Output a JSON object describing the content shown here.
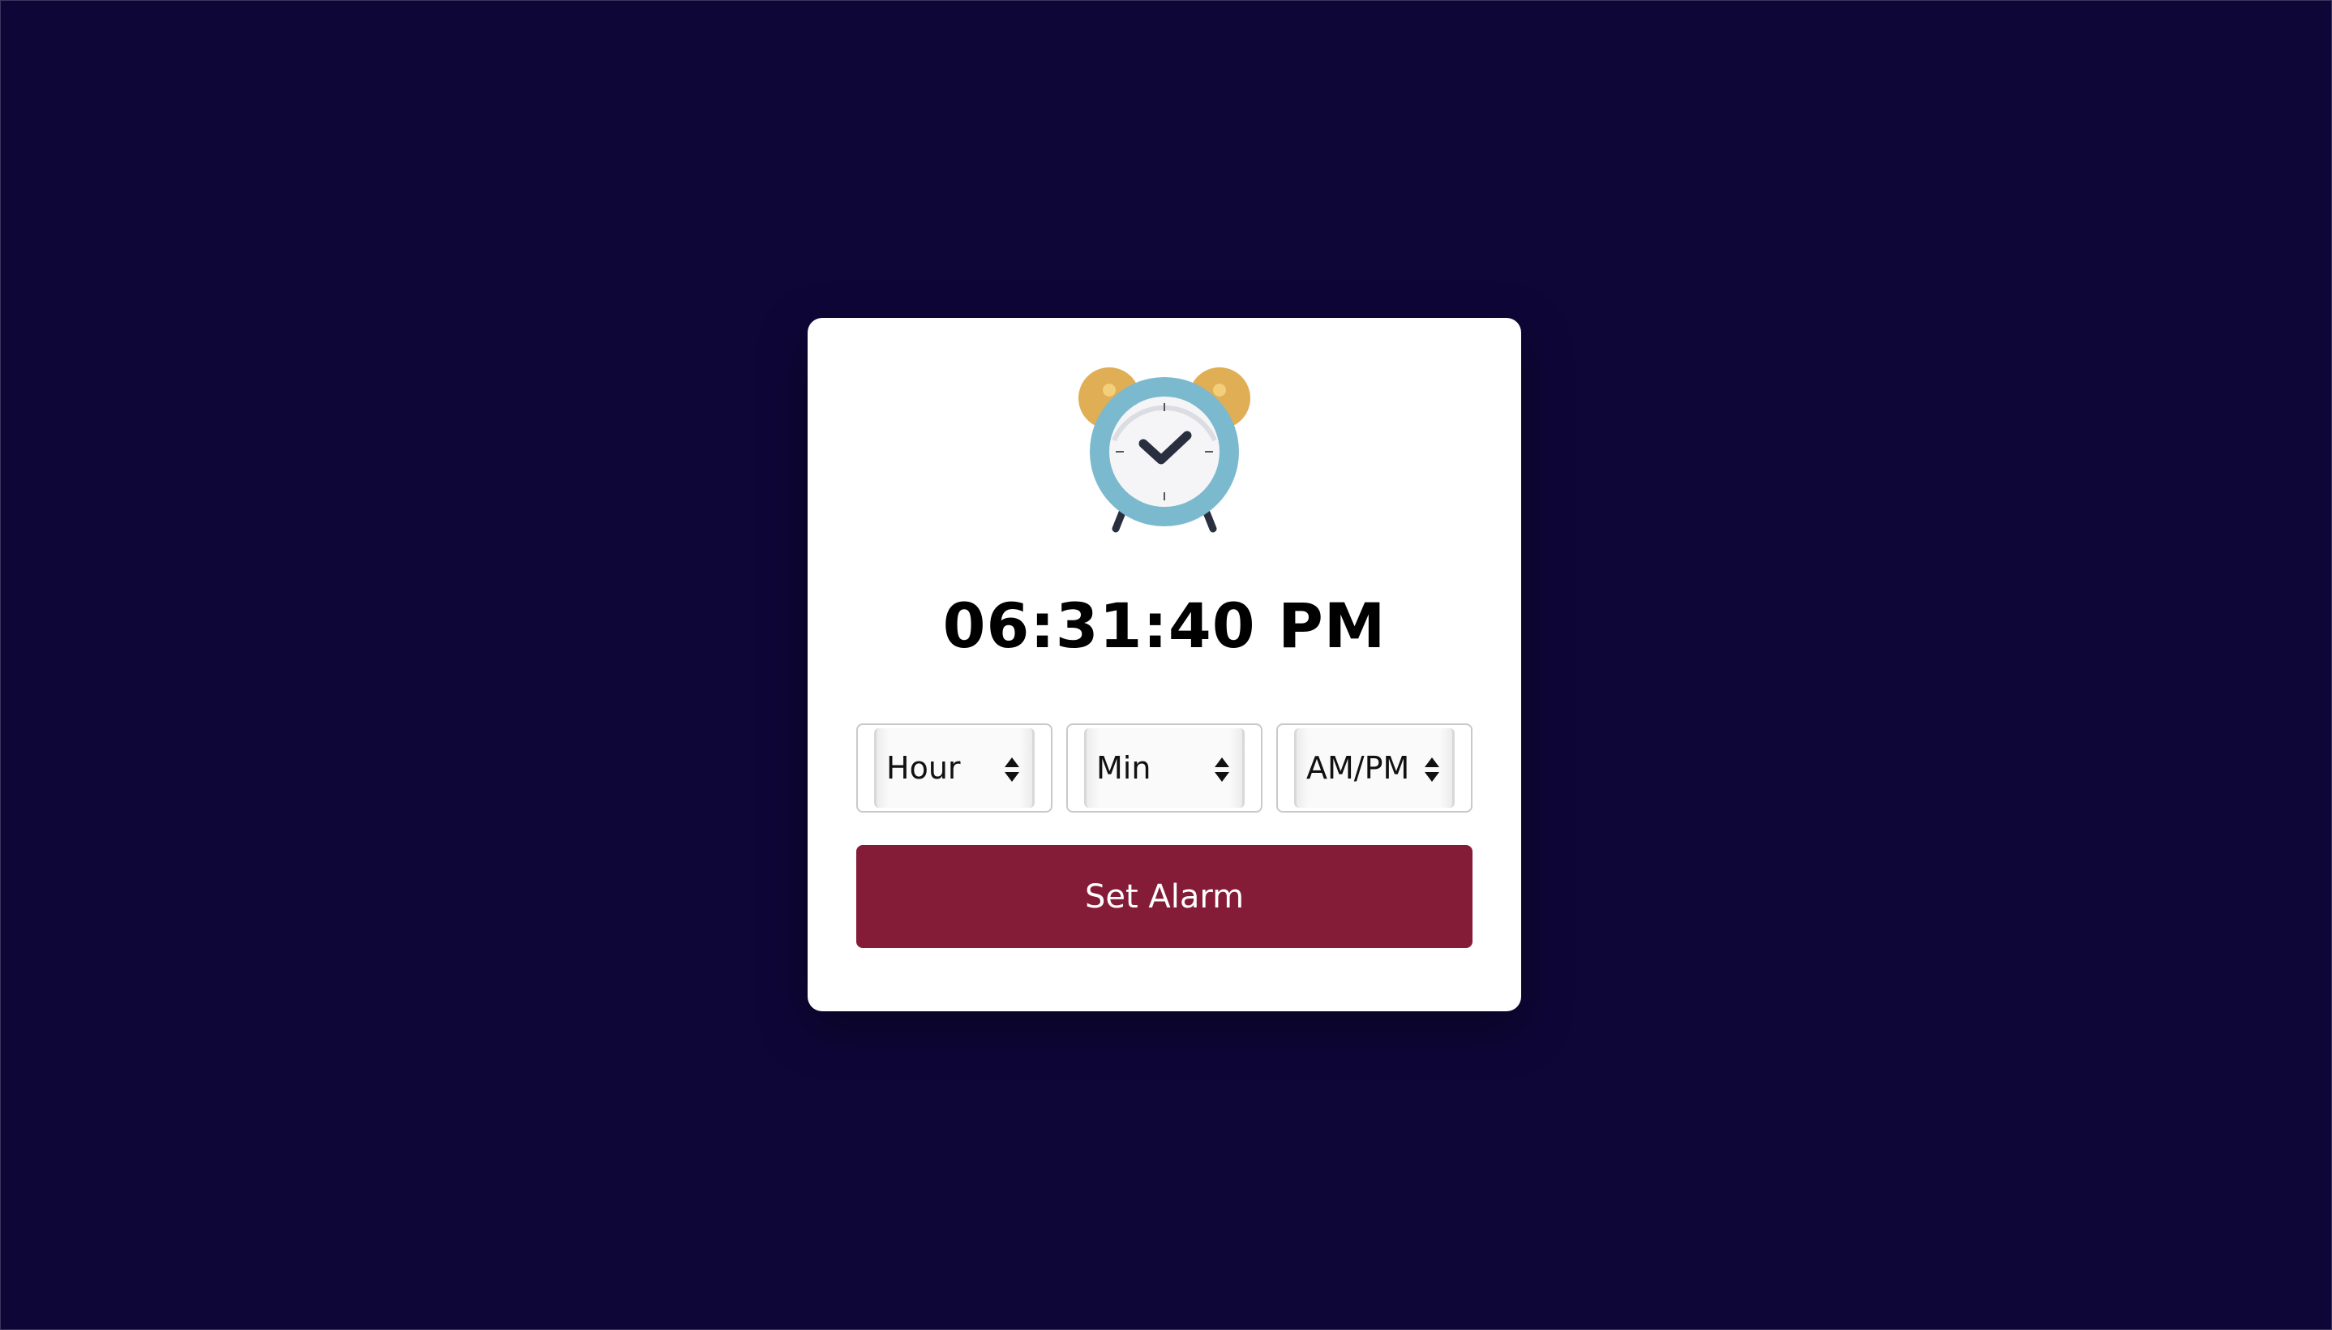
{
  "page": {
    "background_color": "#0e0637"
  },
  "card": {
    "clock_icon": "alarm-clock-icon",
    "time_display": "06:31:40 PM"
  },
  "selects": [
    {
      "label": "Hour",
      "icon": "updown-arrows-icon"
    },
    {
      "label": "Min",
      "icon": "updown-arrows-icon"
    },
    {
      "label": "AM/PM",
      "icon": "updown-arrows-icon"
    }
  ],
  "button": {
    "label": "Set Alarm",
    "color": "#841b37"
  },
  "colors": {
    "bell": "#dfae55",
    "clock_ring": "#7bb9ce",
    "hands": "#2a2f3f"
  }
}
